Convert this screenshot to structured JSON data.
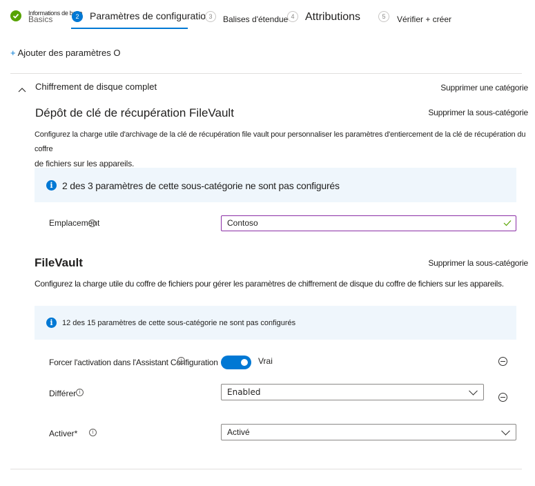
{
  "wizard": {
    "steps": [
      {
        "number": "1",
        "label": "Informations de base",
        "overlap_label": "Basics",
        "state": "completed"
      },
      {
        "number": "2",
        "label": "Paramètres de configuration",
        "state": "current"
      },
      {
        "number": "3",
        "label": "Balises d'étendue",
        "state": "future"
      },
      {
        "number": "4",
        "label": "Attributions",
        "state": "future"
      },
      {
        "number": "5",
        "label": "Vérifier + créer",
        "state": "future"
      }
    ]
  },
  "add_settings": {
    "icon": "+",
    "label": "Ajouter des paramètres O"
  },
  "category": {
    "title": "Chiffrement de disque complet",
    "remove_label": "Supprimer une catégorie",
    "collapse_icon": "chevron-up"
  },
  "subcategories": [
    {
      "title": "Dépôt de clé de récupération FileVault",
      "remove_label": "Supprimer la sous-catégorie",
      "description_line1": "Configurez la charge utile d'archivage de la clé de récupération file vault pour personnaliser les paramètres d'entiercement de la clé de récupération du coffre",
      "description_line2": "de fichiers sur les appareils.",
      "info": "2 des 3 paramètres de cette sous-catégorie ne sont pas configurés",
      "settings": [
        {
          "label": "Emplacement",
          "value": "Contoso",
          "valid": true
        }
      ]
    },
    {
      "title": "FileVault",
      "remove_label": "Supprimer la sous-catégorie",
      "description": "Configurez la charge utile du coffre de fichiers pour gérer les paramètres de chiffrement de disque du coffre de fichiers sur les appareils.",
      "info": "12 des 15 paramètres de cette sous-catégorie ne sont pas configurés",
      "settings": [
        {
          "label": "Forcer l'activation dans l'Assistant Configuration",
          "type": "toggle",
          "on": true,
          "value": "Vrai"
        },
        {
          "label": "Différer",
          "type": "dropdown",
          "value": "Enabled"
        },
        {
          "label": "Activer*",
          "type": "dropdown",
          "value": "Activé"
        }
      ]
    }
  ],
  "colors": {
    "accent": "#0078d4",
    "success": "#57a300",
    "info_bg": "#eff6fc",
    "valid_border": "#8a2da5"
  }
}
